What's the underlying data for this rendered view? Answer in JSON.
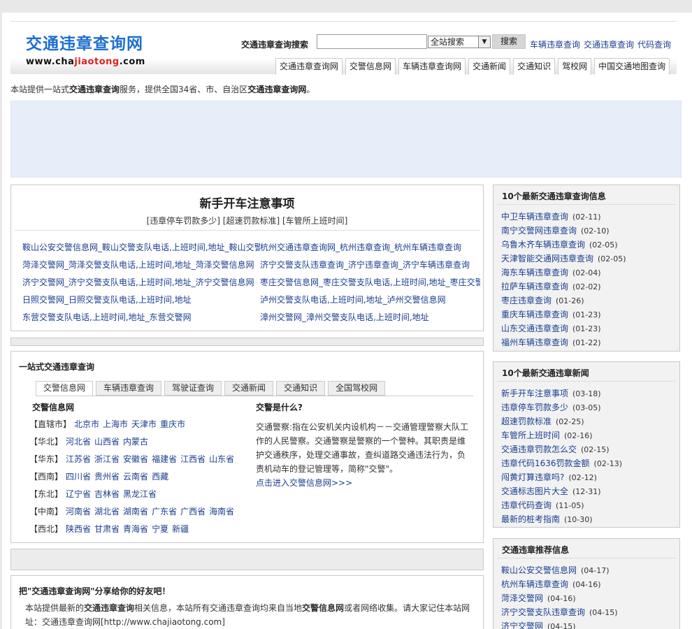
{
  "header": {
    "logo_title": "交通违章查询网",
    "logo_url_pre": "www.cha",
    "logo_url_hl": "jiaotong",
    "logo_url_post": ".com",
    "search_label": "交通违章查询搜索",
    "search_placeholder": "",
    "search_scope": "全站搜索",
    "search_button": "搜索",
    "top_links": [
      "车辆违章查询",
      "交通违章查询",
      "代码查询"
    ]
  },
  "nav": {
    "tabs": [
      "交通违章查询网",
      "交警信息网",
      "车辆违章查询网",
      "交通新闻",
      "交通知识",
      "驾校网",
      "中国交通地图查询"
    ]
  },
  "intro": {
    "p1": "本站提供一站式",
    "b1": "交通违章查询",
    "p2": "服务，提供全国34省、市、自治区",
    "b2": "交通违章查询网",
    "p3": "。"
  },
  "tips": {
    "title": "新手开车注意事项",
    "links": "[违章停车罚款多少] [超速罚款标准] [车管所上班时间]",
    "rows": [
      [
        "鞍山公安交警信息网_鞍山交警支队电话,上班时间,地址_鞍山交警",
        "杭州交通违章查询网_杭州违章查询_杭州车辆违章查询"
      ],
      [
        "菏泽交警网_菏泽交警支队电话,上班时间,地址_菏泽交警信息网",
        "济宁交警支队违章查询_济宁违章查询_济宁车辆违章查询"
      ],
      [
        "济宁交警网_济宁交警支队电话,上班时间,地址_济宁交警信息网",
        "枣庄交警信息网_枣庄交警支队电话,上班时间,地址_枣庄交警网"
      ],
      [
        "日照交警网_日照交警支队电话,上班时间,地址",
        "泸州交警支队电话,上班时间,地址_泸州交警信息网"
      ],
      [
        "东营交警支队电话,上班时间,地址_东营交警网",
        "漳州交警网_漳州交警支队电话,上班时间,地址"
      ]
    ]
  },
  "onestop": {
    "title": "一站式交通违章查询",
    "tabs": [
      "交警信息网",
      "车辆违章查询",
      "驾驶证查询",
      "交通新闻",
      "交通知识",
      "全国驾校网"
    ],
    "left_title": "交警信息网",
    "right_title": "交警是什么?",
    "regions": [
      {
        "name": "【直辖市】",
        "items": [
          "北京市",
          "上海市",
          "天津市",
          "重庆市"
        ]
      },
      {
        "name": "【华北】",
        "items": [
          "河北省",
          "山西省",
          "内蒙古"
        ]
      },
      {
        "name": "【华东】",
        "items": [
          "江苏省",
          "浙江省",
          "安徽省",
          "福建省",
          "江西省",
          "山东省"
        ]
      },
      {
        "name": "【西南】",
        "items": [
          "四川省",
          "贵州省",
          "云南省",
          "西藏"
        ]
      },
      {
        "name": "【东北】",
        "items": [
          "辽宁省",
          "吉林省",
          "黑龙江省"
        ]
      },
      {
        "name": "【中南】",
        "items": [
          "河南省",
          "湖北省",
          "湖南省",
          "广东省",
          "广西省",
          "海南省"
        ]
      },
      {
        "name": "【西北】",
        "items": [
          "陕西省",
          "甘肃省",
          "青海省",
          "宁夏",
          "新疆"
        ]
      }
    ],
    "desc": "交通警察:指在公安机关内设机构－－交通管理警察大队工作的人民警察。交通警察是警察的一个警种。其职责是维护交通秩序，处理交通事故，查纠道路交通违法行为，负责机动车的登记管理等，简称\"交警\"。",
    "more": "点击进入交警信息网>>>"
  },
  "share": {
    "title": "把\"交通违章查询网\"分享给你的好友吧！",
    "t1": "本站提供最新的",
    "b1": "交通违章查询",
    "t2": "相关信息，本站所有交通违章查询均来自当地",
    "b2": "交警信息网",
    "t3": "或者网络收集。请大家记住本站网址：交通违章查询网[http://www.chajiaotong.com]"
  },
  "side1": {
    "title": "10个最新交通违章查询信息",
    "items": [
      {
        "t": "中卫车辆违章查询",
        "d": "(02-11)"
      },
      {
        "t": "南宁交警网违章查询",
        "d": "(02-10)"
      },
      {
        "t": "乌鲁木齐车辆违章查询",
        "d": "(02-05)"
      },
      {
        "t": "天津智能交通网违章查询",
        "d": "(02-05)"
      },
      {
        "t": "海东车辆违章查询",
        "d": "(02-04)"
      },
      {
        "t": "拉萨车辆违章查询",
        "d": "(02-02)"
      },
      {
        "t": "枣庄违章查询",
        "d": "(01-26)"
      },
      {
        "t": "重庆车辆违章查询",
        "d": "(01-23)"
      },
      {
        "t": "山东交通违章查询",
        "d": "(01-23)"
      },
      {
        "t": "福州车辆违章查询",
        "d": "(01-22)"
      }
    ]
  },
  "side2": {
    "title": "10个最新交通违章新闻",
    "items": [
      {
        "t": "新手开车注意事项",
        "d": "(03-18)"
      },
      {
        "t": "违章停车罚款多少",
        "d": "(03-05)"
      },
      {
        "t": "超速罚款标准",
        "d": "(02-25)"
      },
      {
        "t": "车管所上班时间",
        "d": "(02-16)"
      },
      {
        "t": "交通违章罚款怎么交",
        "d": "(02-15)"
      },
      {
        "t": "违章代码1636罚款金额",
        "d": "(02-13)"
      },
      {
        "t": "闯黄灯算违章吗?",
        "d": "(02-12)"
      },
      {
        "t": "交通标志图片大全",
        "d": "(12-31)"
      },
      {
        "t": "违章代码查询",
        "d": "(11-05)"
      },
      {
        "t": "最新的桩考指南",
        "d": "(10-30)"
      }
    ]
  },
  "side3": {
    "title": "交通违章推荐信息",
    "items": [
      {
        "t": "鞍山公安交警信息网",
        "d": "(04-17)"
      },
      {
        "t": "杭州车辆违章查询",
        "d": "(04-16)"
      },
      {
        "t": "菏泽交警网",
        "d": "(04-16)"
      },
      {
        "t": "济宁交警支队违章查询",
        "d": "(04-15)"
      },
      {
        "t": "济宁交警网",
        "d": "(04-15)"
      }
    ]
  }
}
